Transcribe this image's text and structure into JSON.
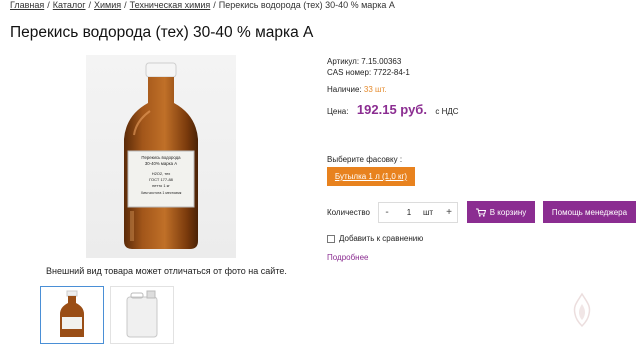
{
  "breadcrumb": {
    "items": [
      "Главная",
      "Каталог",
      "Химия",
      "Техническая химия"
    ],
    "current": "Перекись водорода (тех) 30-40 % марка А",
    "separator": "/"
  },
  "product": {
    "title": "Перекись водорода (тех) 30-40 % марка А",
    "article_label": "Артикул:",
    "article_value": "7.15.00363",
    "cas_label": "CAS номер:",
    "cas_value": "7722-84-1",
    "availability_label": "Наличие:",
    "availability_value": "33 шт.",
    "price_label": "Цена:",
    "price_value": "192.15 руб.",
    "vat_note": "с НДС"
  },
  "gallery": {
    "note": "Внешний вид товара может отличаться от фото на сайте.",
    "bottle_label_lines": [
      "Перекись водорода",
      "30-40% марка А",
      "Н2О2, тех",
      "ГОСТ 177-88",
      "нетто 1 кг",
      "Хим чистота 1 местоимк"
    ]
  },
  "purchase": {
    "pack_label": "Выберите фасовку :",
    "pack_option": "Бутылка 1 л (1,0 кг)",
    "quantity_label": "Количество",
    "minus": "-",
    "quantity_value": "1",
    "unit": "шт",
    "plus": "+",
    "cart_button": "В корзину",
    "manager_button": "Помощь менеджера",
    "compare_label": "Добавить к сравнению",
    "more_link": "Подробнее"
  },
  "colors": {
    "accent": "#8b2d91",
    "orange": "#e8821e",
    "stock": "#e58a2c",
    "thumb_active_border": "#4a8fd6"
  },
  "icons": {
    "cart": "cart-icon",
    "compare_checkbox": "checkbox-icon",
    "logo": "fire-emblem-icon"
  }
}
